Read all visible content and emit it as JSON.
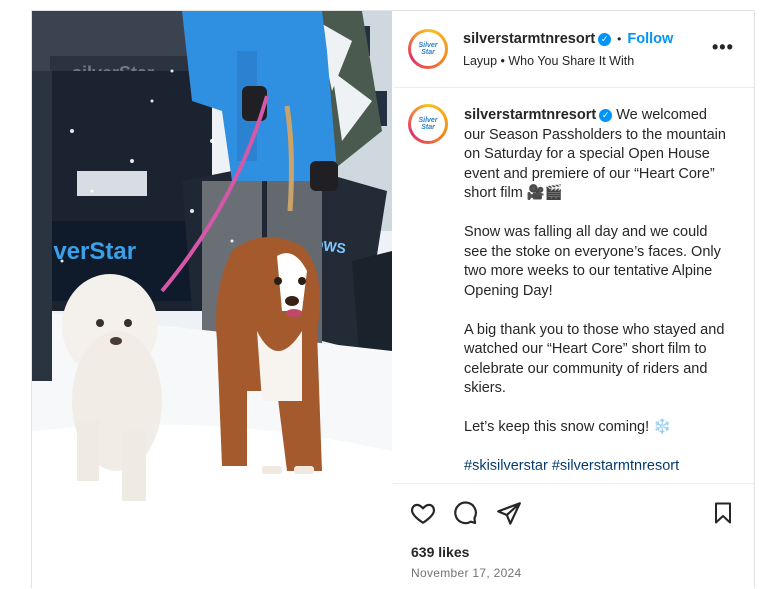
{
  "post": {
    "username": "silverstarmtnresort",
    "follow_label": "Follow",
    "subtitle": "Layup • Who You Share It With",
    "avatar_text_1": "Silver",
    "avatar_text_2": "Star",
    "more_label": "•••",
    "photo_sign_text": "ilverStar",
    "photo_banner_text": "silverStar"
  },
  "caption": {
    "username": "silverstarmtnresort",
    "para1": "We welcomed our Season Passholders to the mountain on Saturday for a special Open House event and premiere of our “Heart Core” short film 🎥🎬",
    "para2": "Snow was falling all day and we could see the stoke on everyone’s faces. Only two more weeks to our tentative Alpine Opening Day!",
    "para3": "A big thank you to those who stayed and watched our “Heart Core” short film to celebrate our community of riders and skiers.",
    "para4": "Let’s keep this snow coming! ❄️",
    "hashtags": "#skisilverstar #silverstarmtnresort"
  },
  "engagement": {
    "likes": "639 likes",
    "date": "November 17, 2024"
  },
  "icons": [
    "heart-icon",
    "comment-icon",
    "share-icon",
    "bookmark-icon",
    "verified-icon"
  ],
  "colors": {
    "accent": "#0095f6",
    "text": "#262626",
    "muted": "#737373",
    "jacket": "#2f8fe0"
  }
}
